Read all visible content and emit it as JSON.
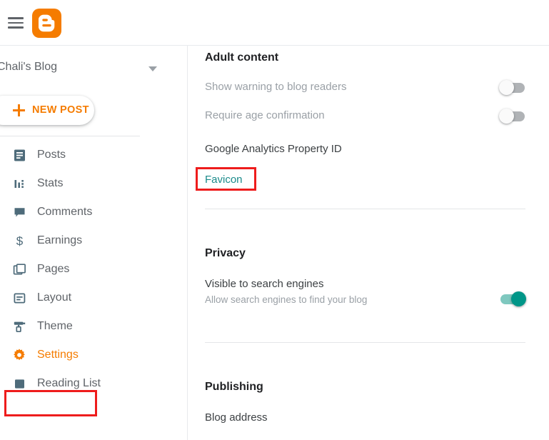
{
  "topbar": {
    "menu_icon": "hamburger-menu-icon",
    "logo_icon": "blogger-logo-icon",
    "logo_color": "#f57c00"
  },
  "sidebar": {
    "blog_name": "Chali's Blog",
    "dropdown_icon": "chevron-down-icon",
    "new_post_label": "NEW POST",
    "new_post_icon": "plus-icon",
    "accent_color": "#f57c00",
    "items": [
      {
        "label": "Posts",
        "icon": "document-icon",
        "active": false
      },
      {
        "label": "Stats",
        "icon": "bar-chart-icon",
        "active": false
      },
      {
        "label": "Comments",
        "icon": "comment-icon",
        "active": false
      },
      {
        "label": "Earnings",
        "icon": "dollar-icon",
        "active": false
      },
      {
        "label": "Pages",
        "icon": "pages-icon",
        "active": false
      },
      {
        "label": "Layout",
        "icon": "layout-icon",
        "active": false
      },
      {
        "label": "Theme",
        "icon": "paint-roller-icon",
        "active": false
      },
      {
        "label": "Settings",
        "icon": "gear-icon",
        "active": true
      },
      {
        "label": "Reading List",
        "icon": "reading-list-icon",
        "active": false
      }
    ]
  },
  "main": {
    "adult_content": {
      "heading": "Adult content",
      "rows": [
        {
          "label": "Show warning to blog readers",
          "toggle": "off"
        },
        {
          "label": "Require age confirmation",
          "toggle": "off"
        }
      ]
    },
    "analytics": {
      "label": "Google Analytics Property ID"
    },
    "favicon": {
      "label": "Favicon",
      "color": "#1a8a8a"
    },
    "privacy": {
      "heading": "Privacy",
      "row": {
        "label": "Visible to search engines",
        "sub": "Allow search engines to find your blog",
        "toggle": "on"
      }
    },
    "publishing": {
      "heading": "Publishing",
      "row": {
        "label": "Blog address"
      }
    }
  },
  "annotations": {
    "color": "#ee1c1c",
    "boxes": [
      {
        "name": "settings-highlight"
      },
      {
        "name": "favicon-highlight"
      }
    ]
  }
}
